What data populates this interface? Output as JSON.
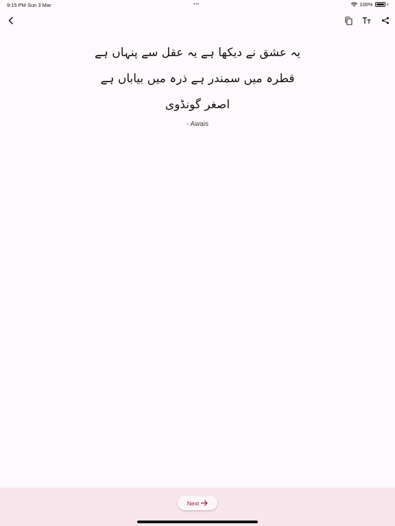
{
  "status_bar": {
    "time": "9:15 PM",
    "date": "Sun 3 Mar",
    "multitask_dots": "•••",
    "battery": "100%"
  },
  "toolbar": {
    "back_icon": "chevron-left-icon",
    "copy_icon": "copy-icon",
    "font_size_icon": "text-size-icon",
    "share_icon": "share-icon"
  },
  "quote": {
    "lines": [
      "یہ عشق نے دیکھا ہے یہ عقل سے پنہاں ہے",
      "قطرہ میں سمندر ہے ذرہ میں بیاباں ہے",
      "اصغر گونڈوی"
    ],
    "author": "- Awais"
  },
  "bottom": {
    "next_label": "Next"
  },
  "colors": {
    "background": "#fdf9fc",
    "bottom_bar": "#f8e6ec",
    "accent": "#8a1c35"
  }
}
